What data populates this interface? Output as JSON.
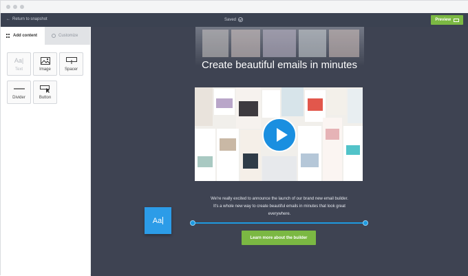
{
  "topbar": {
    "back_label": "Return to snapshot",
    "status": "Saved",
    "preview_label": "Preview"
  },
  "sidebar": {
    "tabs": [
      {
        "label": "Add content",
        "active": true
      },
      {
        "label": "Customize",
        "active": false
      }
    ],
    "blocks": [
      {
        "label": "Text",
        "icon": "text-aa-icon",
        "enabled": false
      },
      {
        "label": "Image",
        "icon": "image-icon",
        "enabled": true
      },
      {
        "label": "Spacer",
        "icon": "spacer-icon",
        "enabled": true
      },
      {
        "label": "Divider",
        "icon": "divider-icon",
        "enabled": true
      },
      {
        "label": "Button",
        "icon": "button-cursor-icon",
        "enabled": true
      }
    ]
  },
  "canvas": {
    "headline": "Create beautiful emails in minutes",
    "description": "We're really excited to announce the launch of our brand new email builder. It's a whole new way to create beautiful emails in minutes that look great everywhere.",
    "text_block_label": "Aa",
    "cta_label": "Learn more about the builder"
  },
  "colors": {
    "topbar": "#3b4251",
    "canvas": "#3e4352",
    "accent_green": "#7bb843",
    "accent_blue": "#1e9ae0"
  }
}
